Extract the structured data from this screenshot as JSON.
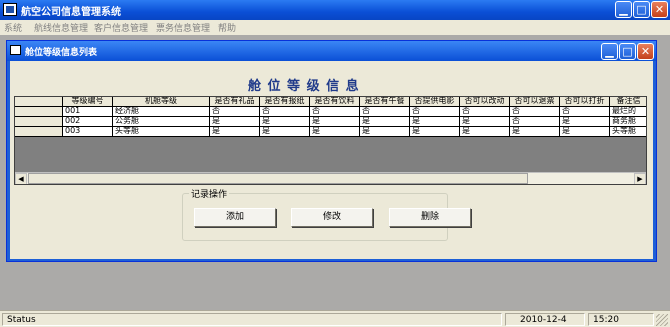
{
  "main_window": {
    "title": "航空公司信息管理系统",
    "menu": [
      "系统",
      "航线信息管理",
      "客户信息管理",
      "票务信息管理",
      "帮助"
    ]
  },
  "child_window": {
    "title": "舱位等级信息列表",
    "heading": "舱 位 等 级 信 息"
  },
  "table": {
    "columns": [
      "",
      "等级编号",
      "机舱等级",
      "是否有礼品",
      "是否有报纸",
      "是否有饮料",
      "是否有午餐",
      "否提供电影",
      "否可以改动",
      "否可以退票",
      "否可以打折",
      "备注信"
    ],
    "rows": [
      [
        "",
        "001",
        "经济舱",
        "否",
        "否",
        "否",
        "否",
        "否",
        "否",
        "否",
        "否",
        "最烂的"
      ],
      [
        "",
        "002",
        "公务舱",
        "是",
        "是",
        "是",
        "是",
        "是",
        "是",
        "否",
        "是",
        "商务舱"
      ],
      [
        "",
        "003",
        "头等舱",
        "是",
        "是",
        "是",
        "是",
        "是",
        "是",
        "是",
        "是",
        "头等舱"
      ]
    ]
  },
  "operations": {
    "group_label": "记录操作",
    "add_label": "添加",
    "edit_label": "修改",
    "delete_label": "删除"
  },
  "statusbar": {
    "status": "Status",
    "date": "2010-12-4",
    "time": "15:20"
  },
  "colors": {
    "title_bar": "#0a58e0",
    "heading_text": "#1f3a8a",
    "grid_bg": "#808080",
    "window_bg": "#ece9d8"
  }
}
